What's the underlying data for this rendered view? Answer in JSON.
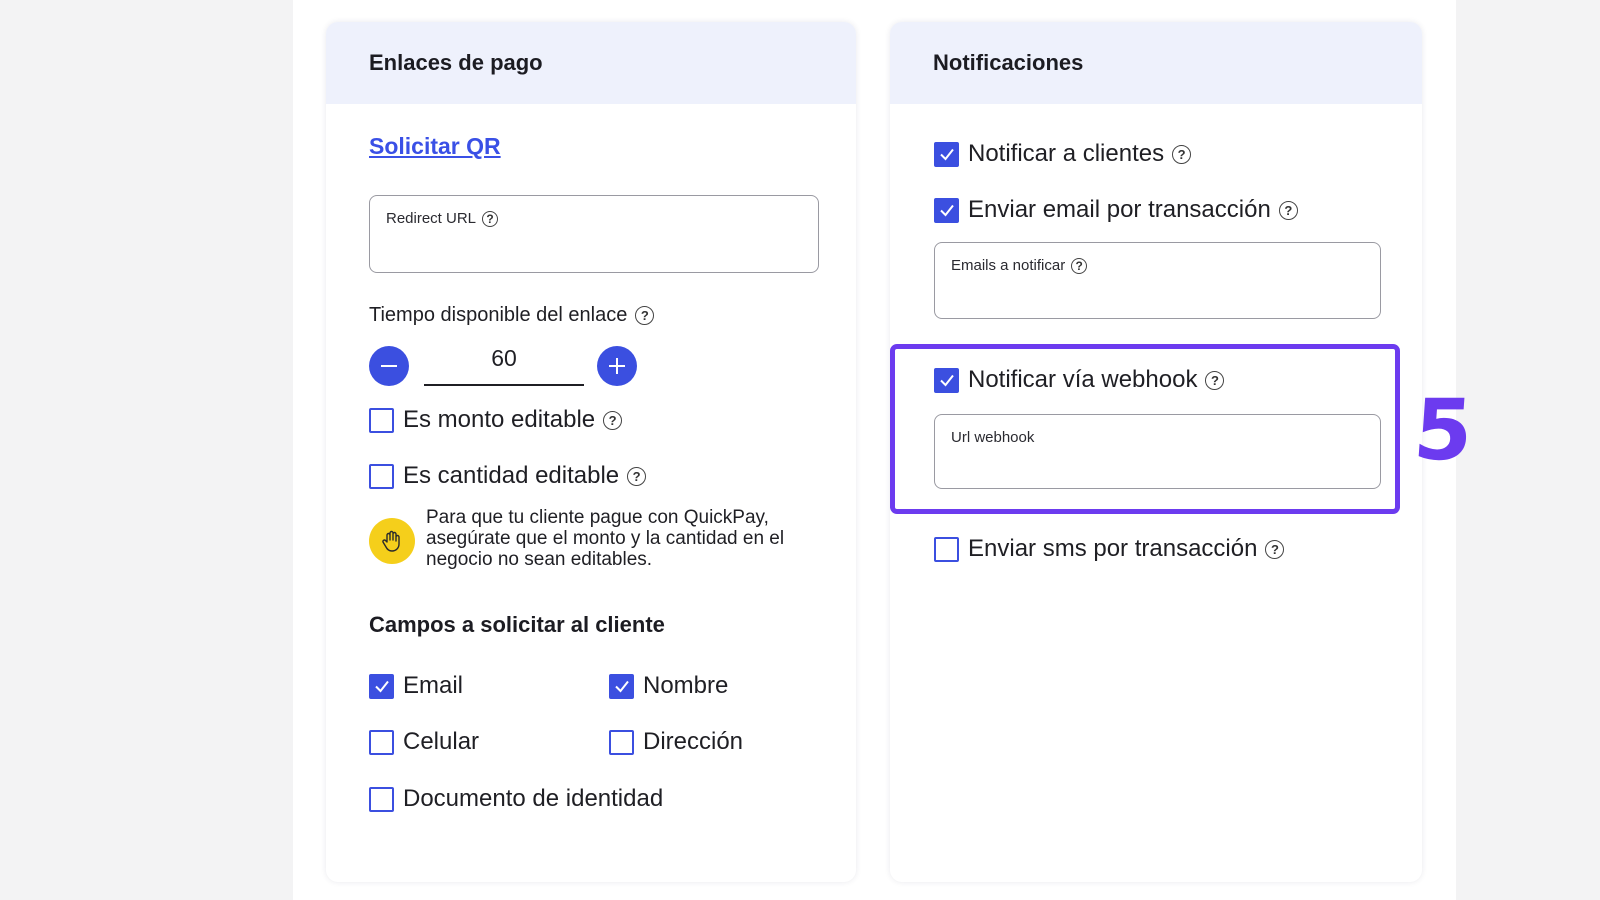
{
  "payment_links": {
    "title": "Enlaces de pago",
    "request_qr_link": "Solicitar QR",
    "redirect_url": {
      "label": "Redirect URL",
      "value": ""
    },
    "link_time": {
      "label": "Tiempo disponible del enlace",
      "value": "60"
    },
    "editable_amount": {
      "label": "Es monto editable",
      "checked": false
    },
    "editable_quantity": {
      "label": "Es cantidad editable",
      "checked": false
    },
    "note": "Para que tu cliente pague con QuickPay, asegúrate que el monto y la cantidad en el negocio no sean editables.",
    "fields_title": "Campos a solicitar al cliente",
    "fields": [
      {
        "label": "Email",
        "checked": true
      },
      {
        "label": "Nombre",
        "checked": true
      },
      {
        "label": "Celular",
        "checked": false
      },
      {
        "label": "Dirección",
        "checked": false
      },
      {
        "label": "Documento de identidad",
        "checked": false
      }
    ]
  },
  "notifications": {
    "title": "Notificaciones",
    "notify_clients": {
      "label": "Notificar a clientes",
      "checked": true
    },
    "email_per_transaction": {
      "label": "Enviar email por transacción",
      "checked": true
    },
    "emails_to_notify": {
      "label": "Emails a notificar",
      "value": ""
    },
    "notify_webhook": {
      "label": "Notificar vía webhook",
      "checked": true
    },
    "webhook_url": {
      "label": "Url webhook",
      "value": ""
    },
    "sms_per_transaction": {
      "label": "Enviar sms por transacción",
      "checked": false
    }
  },
  "annotation": {
    "step_number": "5",
    "color": "#6c3bef"
  },
  "colors": {
    "accent": "#3b4fe0",
    "header_bg": "#eef1fc",
    "warning": "#f5cf1b"
  }
}
